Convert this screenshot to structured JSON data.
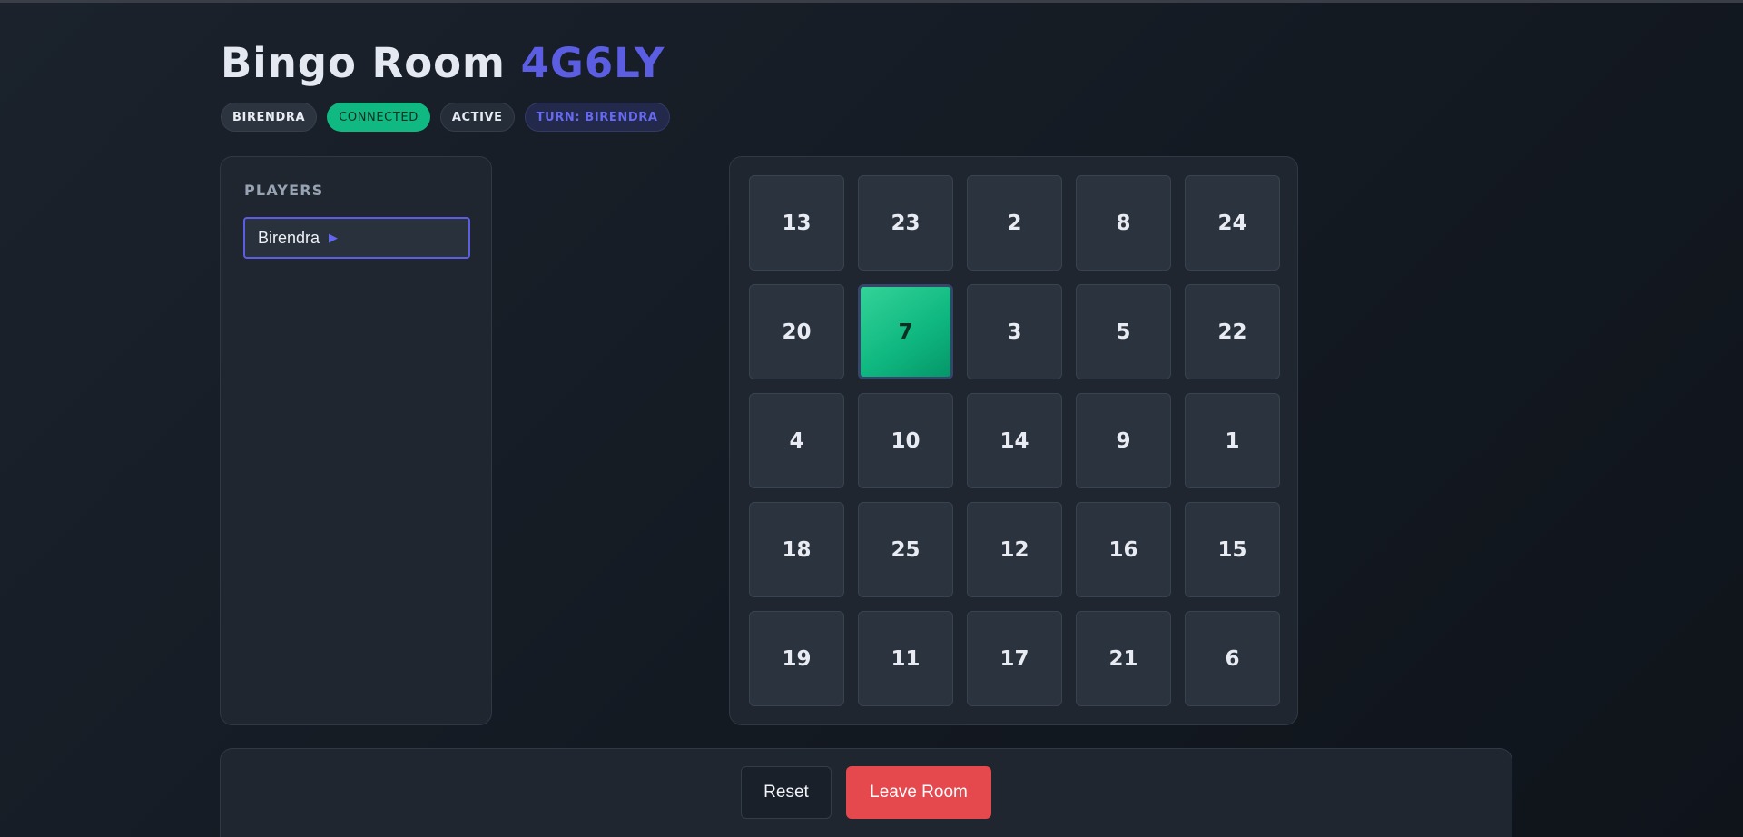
{
  "header": {
    "title_prefix": "Bingo Room",
    "room_code": "4G6LY"
  },
  "badges": {
    "user": "BIRENDRA",
    "connection": "CONNECTED",
    "status": "ACTIVE",
    "turn": "TURN: BIRENDRA"
  },
  "players": {
    "heading": "PLAYERS",
    "items": [
      {
        "name": "Birendra",
        "turn_indicator": "▶"
      }
    ]
  },
  "board": {
    "rows": [
      [
        "13",
        "23",
        "2",
        "8",
        "24"
      ],
      [
        "20",
        "7",
        "3",
        "5",
        "22"
      ],
      [
        "4",
        "10",
        "14",
        "9",
        "1"
      ],
      [
        "18",
        "25",
        "12",
        "16",
        "15"
      ],
      [
        "19",
        "11",
        "17",
        "21",
        "6"
      ]
    ],
    "marked": [
      "7"
    ]
  },
  "actions": {
    "reset_label": "Reset",
    "leave_label": "Leave Room"
  },
  "colors": {
    "accent": "#5b5ee3",
    "connected": "#10b981",
    "danger": "#e5484d",
    "marked_cell": "#10b981"
  }
}
